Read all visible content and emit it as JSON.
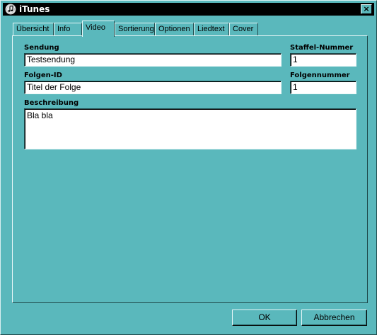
{
  "window": {
    "title": "iTunes",
    "close_label": "×"
  },
  "tabs": [
    {
      "label": "Übersicht",
      "active": false
    },
    {
      "label": "Info",
      "active": false
    },
    {
      "label": "Video",
      "active": true
    },
    {
      "label": "Sortierung",
      "active": false
    },
    {
      "label": "Optionen",
      "active": false
    },
    {
      "label": "Liedtext",
      "active": false
    },
    {
      "label": "Cover",
      "active": false
    }
  ],
  "form": {
    "sendung_label": "Sendung",
    "sendung_value": "Testsendung",
    "staffel_label": "Staffel-Nummer",
    "staffel_value": "1",
    "folgen_id_label": "Folgen-ID",
    "folgen_id_value": "Titel der Folge",
    "folgennummer_label": "Folgennummer",
    "folgennummer_value": "1",
    "beschreibung_label": "Beschreibung",
    "beschreibung_value": "Bla bla"
  },
  "buttons": {
    "ok_label": "OK",
    "cancel_label": "Abbrechen"
  },
  "colors": {
    "window_background": "#5ab8bc",
    "titlebar": "#000000",
    "field_background": "#ffffff"
  }
}
